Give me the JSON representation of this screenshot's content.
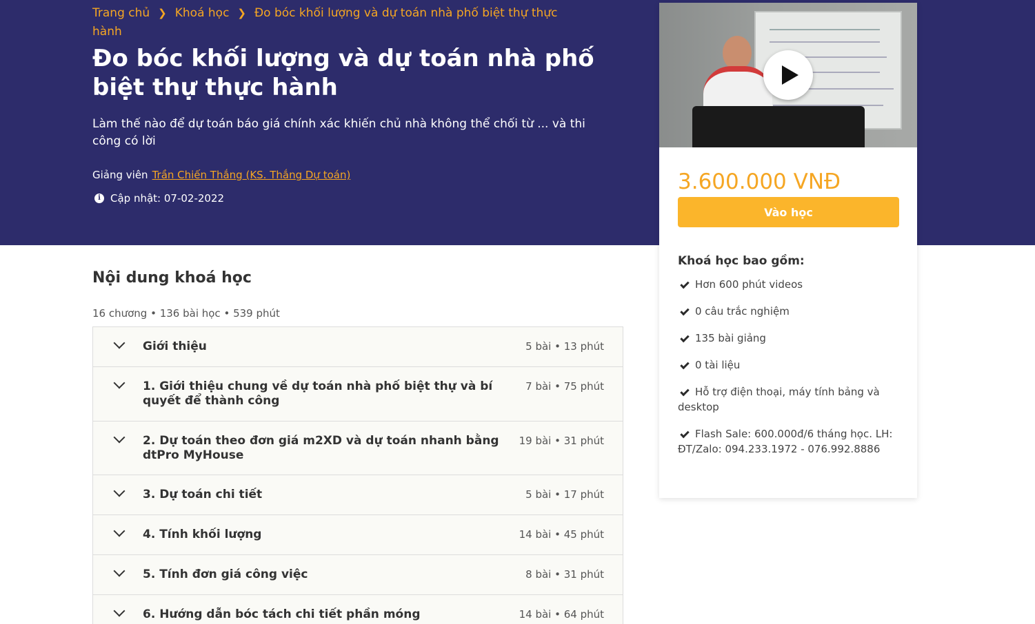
{
  "breadcrumb": {
    "home": "Trang chủ",
    "courses": "Khoá học",
    "current": "Đo bóc khối lượng và dự toán nhà phố biệt thự thực hành"
  },
  "course": {
    "title": "Đo bóc khối lượng và dự toán nhà phố biệt thự thực hành",
    "subtitle": "Làm thế nào để dự toán báo giá chính xác khiến chủ nhà không thể chối từ ... và thi công có lời",
    "instructor_label": "Giảng viên",
    "instructor_name": "Trần Chiến Thắng (KS. Thắng Dự toán)",
    "updated": "Cập nhật: 07-02-2022"
  },
  "card": {
    "price": "3.600.000 VNĐ",
    "enroll_label": "Vào học",
    "includes_title": "Khoá học bao gồm:",
    "includes": [
      "Hơn 600 phút videos",
      "0 câu trắc nghiệm",
      "135 bài giảng",
      "0 tài liệu",
      "Hỗ trợ điện thoại, máy tính bảng và desktop",
      "Flash Sale: 600.000đ/6 tháng học. LH: ĐT/Zalo: 094.233.1972 - 076.992.8886"
    ]
  },
  "content": {
    "title": "Nội dung khoá học",
    "meta": "16 chương • 136 bài học • 539 phút",
    "chapters": [
      {
        "title": "Giới thiệu",
        "meta": "5 bài • 13 phút"
      },
      {
        "title": "1. Giới thiệu chung về dự toán nhà phố biệt thự và bí quyết để thành công",
        "meta": "7 bài • 75 phút"
      },
      {
        "title": "2. Dự toán theo đơn giá m2XD và dự toán nhanh bằng dtPro MyHouse",
        "meta": "19 bài • 31 phút"
      },
      {
        "title": "3. Dự toán chi tiết",
        "meta": "5 bài • 17 phút"
      },
      {
        "title": "4. Tính khối lượng",
        "meta": "14 bài • 45 phút"
      },
      {
        "title": "5. Tính đơn giá công việc",
        "meta": "8 bài • 31 phút"
      },
      {
        "title": "6. Hướng dẫn bóc tách chi tiết phần móng",
        "meta": "14 bài • 64 phút"
      }
    ]
  },
  "colors": {
    "hero_bg": "#2d2c6b",
    "accent": "#f5a623",
    "button": "#fbb52b"
  }
}
